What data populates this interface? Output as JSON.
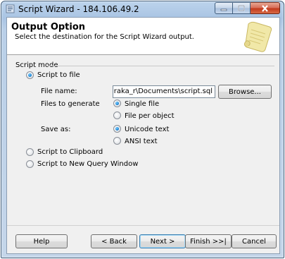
{
  "window": {
    "title": "Script Wizard - 184.106.49.2"
  },
  "header": {
    "title": "Output Option",
    "subtitle": "Select the destination for the Script Wizard output."
  },
  "script_mode": {
    "label": "Script mode",
    "to_file_label": "Script to file",
    "file_name_label": "File name:",
    "file_name_value": "ers\\tharaka_r\\Documents\\script.sql",
    "browse_label": "Browse...",
    "files_to_generate_label": "Files to generate",
    "single_file_label": "Single file",
    "file_per_object_label": "File per object",
    "save_as_label": "Save as:",
    "unicode_label": "Unicode text",
    "ansi_label": "ANSI text",
    "to_clipboard_label": "Script to Clipboard",
    "to_new_query_label": "Script to New Query Window"
  },
  "footer": {
    "help_label": "Help",
    "back_label": "< Back",
    "next_label": "Next >",
    "finish_label": "Finish >>|",
    "cancel_label": "Cancel"
  }
}
